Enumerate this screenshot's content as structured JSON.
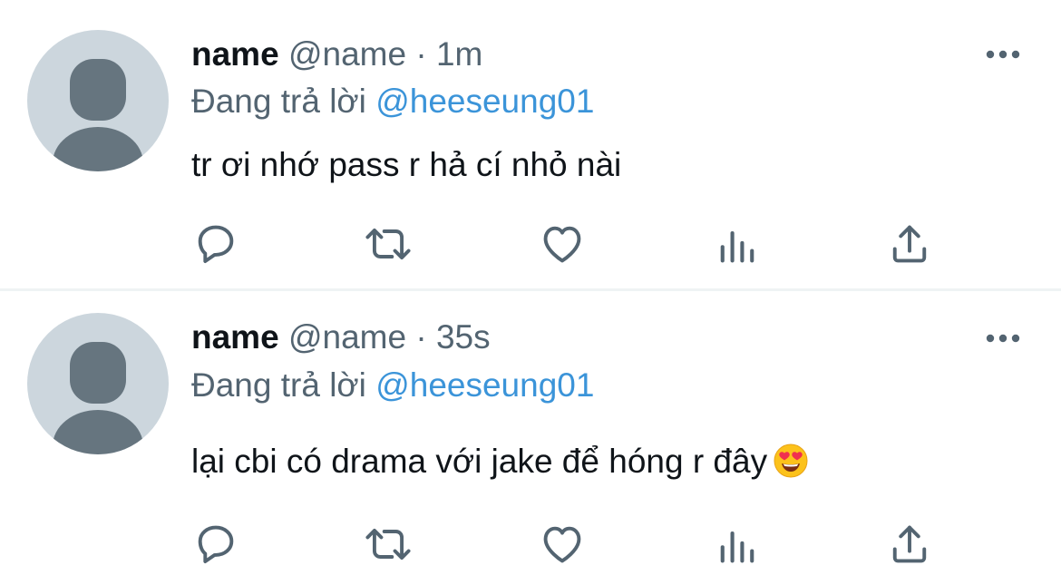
{
  "tweets": [
    {
      "display_name": "name",
      "handle": "@name",
      "separator": "·",
      "time": "1m",
      "replying_prefix": "Đang trả lời",
      "replying_to": "@heeseung01",
      "text": "tr ơi nhớ pass r hả cí nhỏ nài",
      "emoji": null
    },
    {
      "display_name": "name",
      "handle": "@name",
      "separator": "·",
      "time": "35s",
      "replying_prefix": "Đang trả lời",
      "replying_to": "@heeseung01",
      "text": "lại cbi có drama với jake để hóng r đây",
      "emoji": "smiling-face-with-heart-eyes"
    }
  ],
  "actions": [
    "reply-icon",
    "retweet-icon",
    "like-icon",
    "views-icon",
    "share-icon"
  ],
  "colors": {
    "text_primary": "#0f1419",
    "text_secondary": "#536471",
    "mention": "#3b94d9",
    "icon": "#536471",
    "avatar_bg": "#ccd6dd",
    "avatar_fg": "#66757f",
    "divider": "#eff3f4"
  }
}
